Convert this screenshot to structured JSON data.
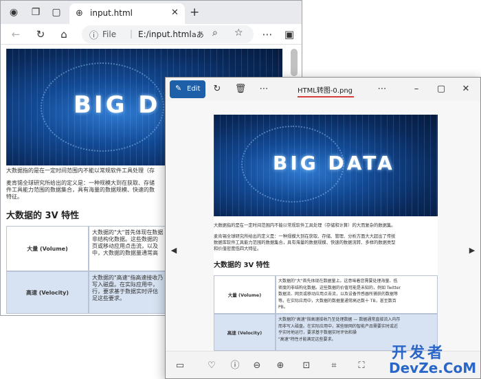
{
  "browser": {
    "tab_title": "input.html",
    "address_label": "File",
    "address_path": "E:/input.html",
    "icons": [
      "profile-icon",
      "workspaces-icon",
      "tab-actions-icon",
      "back-icon",
      "refresh-icon",
      "home-icon",
      "read-aloud-icon",
      "zoom-icon",
      "favorite-icon",
      "sidebar-icon"
    ]
  },
  "page": {
    "hero_text": "BIG D",
    "para1": "大数据指的是在一定时间范围内不能以常规软件工具处理（存",
    "para2a": "麦肯锡全球研究所给出的定义是：一种规模大到在获取、存储",
    "para2b": "件工具能力范围的数据集合，具有海量的数据规模、快速的数",
    "para2c": "特征。",
    "section_title": "大数据的 3V 特性",
    "rows": [
      {
        "name": "大量 (Volume)",
        "lines": [
          "大数据的\"大\"首先体现在数据",
          "非结构化数据。这些数据的",
          "页或移动应用点击流，以及",
          "中，大数据的数据量通常高"
        ]
      },
      {
        "name": "高速 (Velocity)",
        "lines": [
          "大数据的\"高速\"指高速接收乃",
          "写入磁盘。在实际应用中，",
          "行，要求基于数据实时评估",
          "足这些要求。"
        ]
      }
    ]
  },
  "photos": {
    "edit_label": "Edit",
    "file_title": "HTML转图-0.png",
    "image": {
      "hero_text": "BIG DATA",
      "para1": "大数据指的是在一定时间范围内不能以常规软件工具处理（存储和计算）的大而复杂的数据集。",
      "para2a": "麦肯锡全球研究所给出的定义是：一种规模大到在获取、存储、管理、分析方面大大超出了传统",
      "para2b": "数据库软件工具能力范围的数据集合，具有海量的数据规模、快速的数据流转、多样的数据类型",
      "para2c": "和价值密度低四大特征。",
      "section_title": "大数据的 3V 特性",
      "rows": [
        {
          "name": "大量 (Volume)",
          "lines": [
            "大数据的\"大\"首先体现在数据量上。这意味着您需要处理海量、低",
            "密度的非结构化数据。这些数据的价值可能是未知的，例如 Twitter",
            "数据流、网页或移动应用点击流，以及设备传感器所捕获的数据等",
            "等。在实际应用中，大数据的数据量通常高达数十 TB，甚至数百",
            "PB。"
          ]
        },
        {
          "name": "高速 (Velocity)",
          "lines": [
            "大数据的\"高速\"指高速接收乃至处理数据 — 数据通常直接流入内存",
            "而非写入磁盘。在实际应用中，某些联网的智能产品需要实时或近",
            "乎实时地运行，要求基于数据实时评估和操",
            "\"高速\"特性才能满足这些要求。"
          ]
        }
      ]
    }
  },
  "watermark": {
    "cn": "开发者",
    "en": "DevZe.CoM"
  },
  "colors": {
    "accent": "#1d5fa8",
    "watermark": "#2a66c8",
    "title_underline": "#d63c3c"
  }
}
